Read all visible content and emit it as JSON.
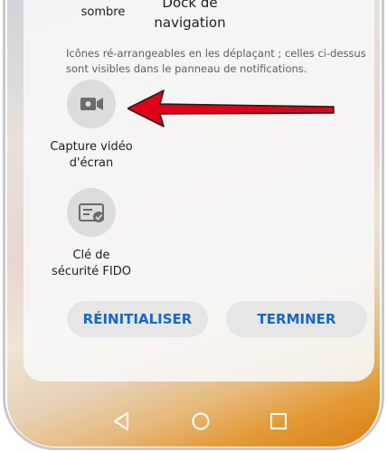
{
  "tiles_top": [
    {
      "label": "Mode\nsombre"
    },
    {
      "label": "Dock de\nnavigation"
    }
  ],
  "hint_text": "Icônes ré-arrangeables en les déplaçant ; celles ci-dessus sont visibles dans le panneau de notifications.",
  "tiles": [
    {
      "label": "Capture vidéo\nd'écran",
      "icon": "video-camera-icon"
    },
    {
      "label": "Clé de\nsécurité FIDO",
      "icon": "security-key-icon"
    }
  ],
  "buttons": {
    "reset": "RÉINITIALISER",
    "done": "TERMINER"
  },
  "nav_bar": {
    "back": "back-triangle-icon",
    "home": "home-circle-icon",
    "recent": "recent-square-icon"
  },
  "colors": {
    "accent": "#1a66c8",
    "arrow": "#e0001a",
    "tile_bg": "#dcdcdc",
    "button_bg": "#e6e6e6"
  }
}
